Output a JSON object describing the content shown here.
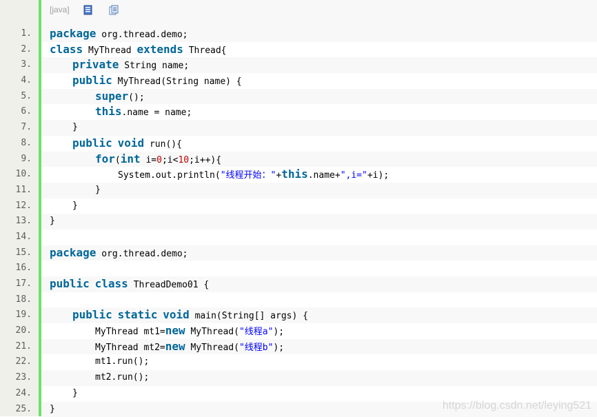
{
  "toolbar": {
    "language_label": "[java]",
    "view_icon": "view-source-icon",
    "copy_icon": "copy-icon"
  },
  "lines": [
    {
      "n": "1.",
      "tokens": [
        [
          "k",
          "package"
        ],
        [
          "p",
          " org.thread.demo;"
        ]
      ],
      "indent": 0
    },
    {
      "n": "2.",
      "tokens": [
        [
          "k",
          "class"
        ],
        [
          "p",
          " MyThread "
        ],
        [
          "k",
          "extends"
        ],
        [
          "p",
          " Thread{"
        ]
      ],
      "indent": 0
    },
    {
      "n": "3.",
      "tokens": [
        [
          "k",
          "private"
        ],
        [
          "p",
          " String name;"
        ]
      ],
      "indent": 1
    },
    {
      "n": "4.",
      "tokens": [
        [
          "k",
          "public"
        ],
        [
          "p",
          " MyThread(String name) {"
        ]
      ],
      "indent": 1
    },
    {
      "n": "5.",
      "tokens": [
        [
          "k",
          "super"
        ],
        [
          "p",
          "();"
        ]
      ],
      "indent": 2
    },
    {
      "n": "6.",
      "tokens": [
        [
          "k",
          "this"
        ],
        [
          "p",
          ".name = name;"
        ]
      ],
      "indent": 2
    },
    {
      "n": "7.",
      "tokens": [
        [
          "p",
          "}"
        ]
      ],
      "indent": 1
    },
    {
      "n": "8.",
      "tokens": [
        [
          "k",
          "public"
        ],
        [
          "p",
          " "
        ],
        [
          "k",
          "void"
        ],
        [
          "p",
          " run(){"
        ]
      ],
      "indent": 1
    },
    {
      "n": "9.",
      "tokens": [
        [
          "k",
          "for"
        ],
        [
          "p",
          "("
        ],
        [
          "k",
          "int"
        ],
        [
          "p",
          " i="
        ],
        [
          "d",
          "0"
        ],
        [
          "p",
          ";i<"
        ],
        [
          "d",
          "10"
        ],
        [
          "p",
          ";i++){"
        ]
      ],
      "indent": 2
    },
    {
      "n": "10.",
      "tokens": [
        [
          "p",
          "System.out.println("
        ],
        [
          "s",
          "\"线程开始：\""
        ],
        [
          "p",
          "+"
        ],
        [
          "k",
          "this"
        ],
        [
          "p",
          ".name+"
        ],
        [
          "s",
          "\",i=\""
        ],
        [
          "p",
          "+i);"
        ]
      ],
      "indent": 3
    },
    {
      "n": "11.",
      "tokens": [
        [
          "p",
          "}"
        ]
      ],
      "indent": 2
    },
    {
      "n": "12.",
      "tokens": [
        [
          "p",
          "}"
        ]
      ],
      "indent": 1
    },
    {
      "n": "13.",
      "tokens": [
        [
          "p",
          "}"
        ]
      ],
      "indent": 0
    },
    {
      "n": "14.",
      "tokens": [],
      "indent": 0
    },
    {
      "n": "15.",
      "tokens": [
        [
          "k",
          "package"
        ],
        [
          "p",
          " org.thread.demo;"
        ]
      ],
      "indent": 0
    },
    {
      "n": "16.",
      "tokens": [],
      "indent": 0
    },
    {
      "n": "17.",
      "tokens": [
        [
          "k",
          "public"
        ],
        [
          "p",
          " "
        ],
        [
          "k",
          "class"
        ],
        [
          "p",
          " ThreadDemo01 {"
        ]
      ],
      "indent": 0
    },
    {
      "n": "18.",
      "tokens": [],
      "indent": 0
    },
    {
      "n": "19.",
      "tokens": [
        [
          "k",
          "public"
        ],
        [
          "p",
          " "
        ],
        [
          "k",
          "static"
        ],
        [
          "p",
          " "
        ],
        [
          "k",
          "void"
        ],
        [
          "p",
          " main(String[] args) {"
        ]
      ],
      "indent": 1
    },
    {
      "n": "20.",
      "tokens": [
        [
          "p",
          "MyThread mt1="
        ],
        [
          "k",
          "new"
        ],
        [
          "p",
          " MyThread("
        ],
        [
          "s",
          "\"线程a\""
        ],
        [
          "p",
          ");"
        ]
      ],
      "indent": 2
    },
    {
      "n": "21.",
      "tokens": [
        [
          "p",
          "MyThread mt2="
        ],
        [
          "k",
          "new"
        ],
        [
          "p",
          " MyThread("
        ],
        [
          "s",
          "\"线程b\""
        ],
        [
          "p",
          ");"
        ]
      ],
      "indent": 2
    },
    {
      "n": "22.",
      "tokens": [
        [
          "p",
          "mt1.run();"
        ]
      ],
      "indent": 2
    },
    {
      "n": "23.",
      "tokens": [
        [
          "p",
          "mt2.run();"
        ]
      ],
      "indent": 2
    },
    {
      "n": "24.",
      "tokens": [
        [
          "p",
          "}"
        ]
      ],
      "indent": 1
    },
    {
      "n": "25.",
      "tokens": [
        [
          "p",
          "}"
        ]
      ],
      "indent": 0
    }
  ],
  "watermark": "https://blog.csdn.net/leying521",
  "colors": {
    "keyword": "#006699",
    "string": "#0000ff",
    "number": "#c00000",
    "gutter_bar": "#6ce26c"
  }
}
